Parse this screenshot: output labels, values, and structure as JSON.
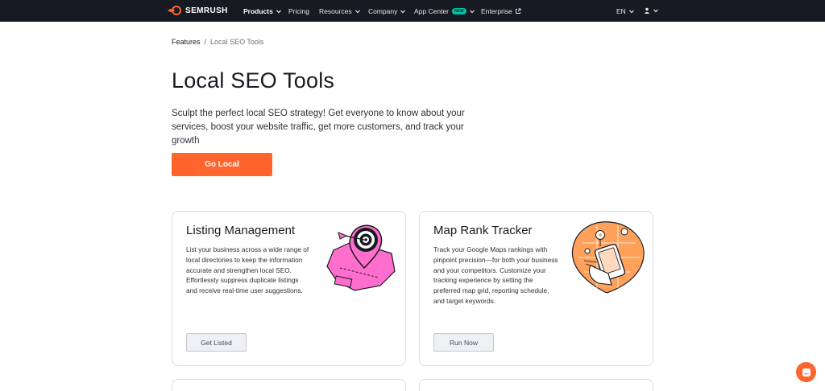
{
  "nav": {
    "logo_text": "SEMRUSH",
    "items": [
      {
        "label": "Products"
      },
      {
        "label": "Pricing"
      },
      {
        "label": "Resources"
      },
      {
        "label": "Company"
      },
      {
        "label": "App Center",
        "badge": "NEW"
      },
      {
        "label": "Enterprise"
      }
    ],
    "language": "EN"
  },
  "breadcrumb": {
    "parent": "Features",
    "separator": "/",
    "current": "Local SEO Tools"
  },
  "hero": {
    "title": "Local SEO Tools",
    "subtitle": "Sculpt the perfect local SEO strategy! Get everyone to know about your services, boost your website traffic, get more customers, and track your growth",
    "cta_label": "Go Local"
  },
  "cards": [
    {
      "title": "Listing Management",
      "description": "List your business across a wide range of local directories to keep the information accurate and strengthen local SEO. Effortlessly suppress duplicate listings and receive real-time user suggestions.",
      "button_label": "Get Listed",
      "art_color": "#ff6ecd"
    },
    {
      "title": "Map Rank Tracker",
      "description": "Track your Google Maps rankings with pinpoint precision—for both your business and your competitors. Customize your tracking experience by setting the preferred map grid, reporting schedule, and target keywords.",
      "button_label": "Run Now",
      "art_color": "#ffa15a"
    }
  ],
  "colors": {
    "nav_bg": "#171a22",
    "accent": "#ff642d",
    "new_badge": "#00c3a5"
  },
  "icons": [
    "semrush-logo-icon",
    "chevron-down-icon",
    "external-link-icon",
    "user-icon",
    "chat-icon"
  ]
}
